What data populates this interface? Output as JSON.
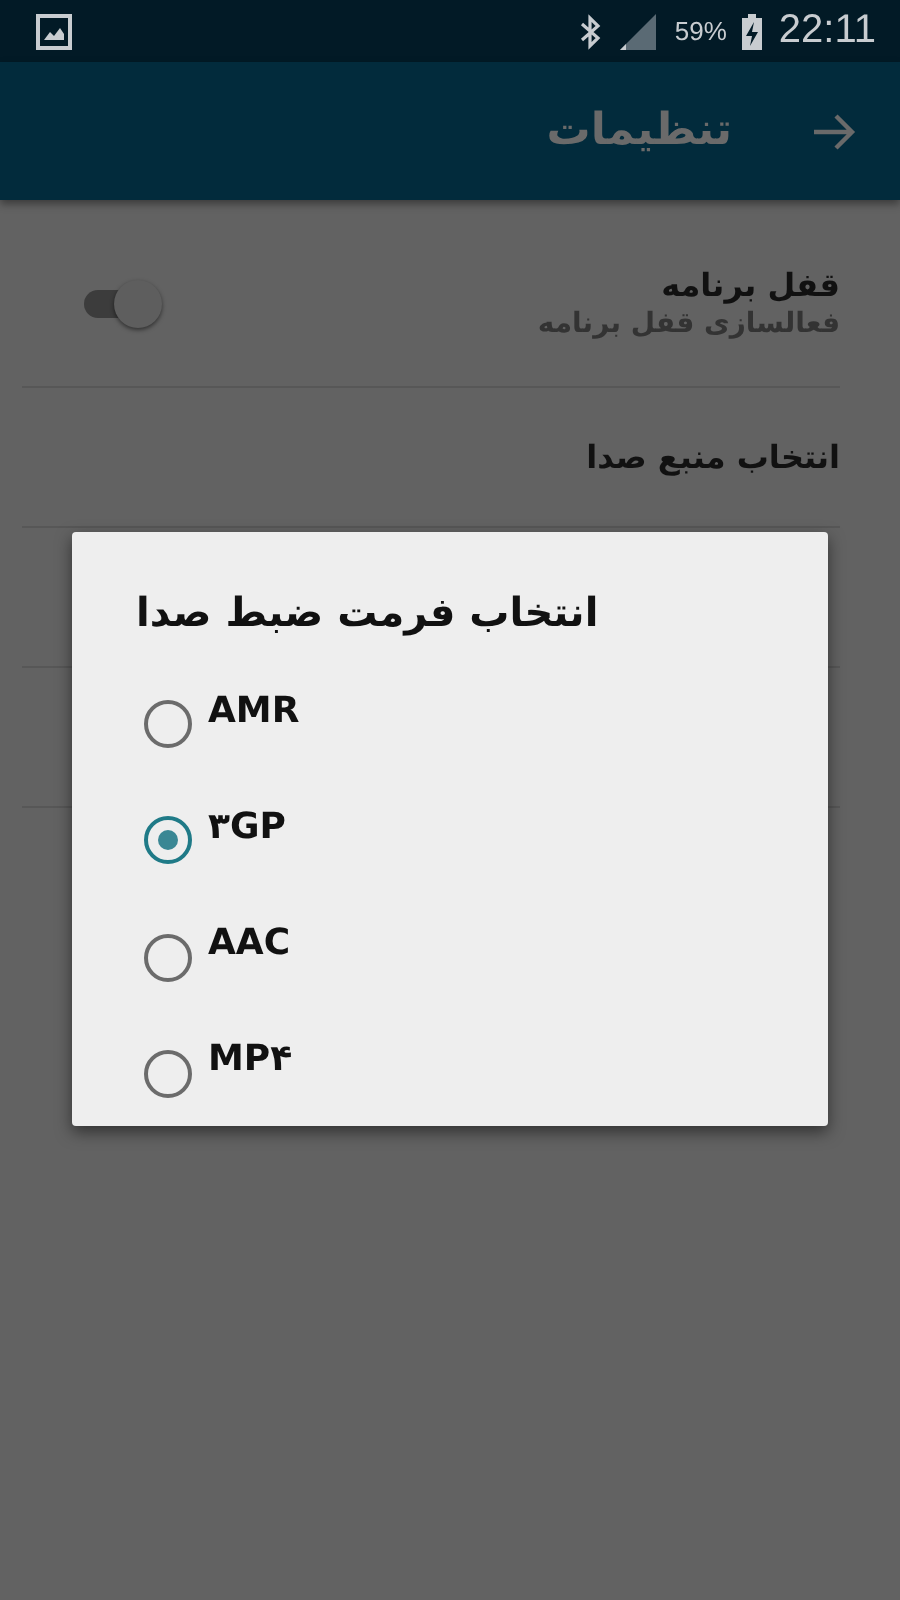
{
  "status_bar": {
    "battery": "59%",
    "time": "22:11"
  },
  "app_bar": {
    "title": "تنظیمات"
  },
  "settings": [
    {
      "kind": "switch",
      "title": "قفل برنامه",
      "subtitle": "فعالسازی قفل برنامه",
      "on": false
    },
    {
      "kind": "plain",
      "title": "انتخاب منبع صدا"
    }
  ],
  "dialog": {
    "title": "انتخاب فرمت ضبط صدا",
    "options": [
      {
        "label": "AMR",
        "selected": false
      },
      {
        "label": "۳GP",
        "selected": true
      },
      {
        "label": "AAC",
        "selected": false
      },
      {
        "label": "MP۴",
        "selected": false
      }
    ]
  }
}
